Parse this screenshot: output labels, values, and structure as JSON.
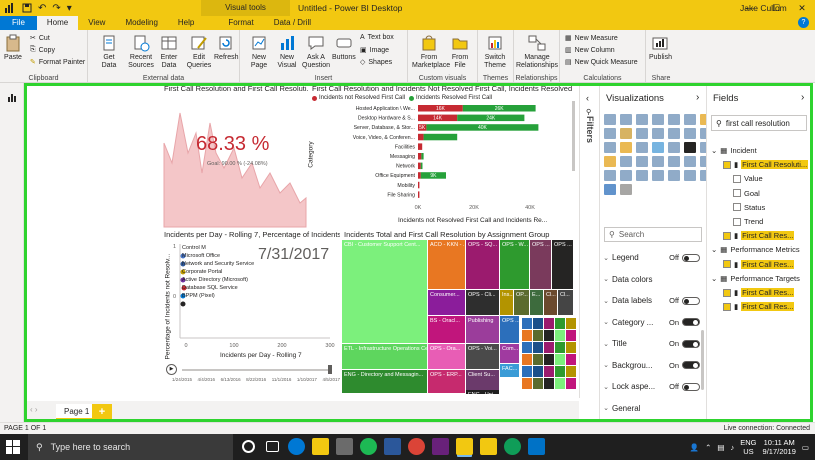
{
  "window": {
    "title": "Untitled - Power BI Desktop",
    "context_tab_group": "Visual tools",
    "user": "Jake Cullom"
  },
  "tabs": [
    {
      "label": "File"
    },
    {
      "label": "Home"
    },
    {
      "label": "View"
    },
    {
      "label": "Modeling"
    },
    {
      "label": "Help"
    },
    {
      "label": "Format"
    },
    {
      "label": "Data / Drill"
    }
  ],
  "ribbon": {
    "paste": "Paste",
    "cut": "Cut",
    "copy": "Copy",
    "format_painter": "Format Painter",
    "clipboard": "Clipboard",
    "get_data": "Get Data",
    "recent_sources": "Recent Sources",
    "enter_data": "Enter Data",
    "edit_queries": "Edit Queries",
    "external_data": "External data",
    "refresh": "Refresh",
    "new_page": "New Page",
    "new_visual": "New Visual",
    "ask_question": "Ask A Question",
    "buttons": "Buttons",
    "text_box": "Text box",
    "image": "Image",
    "shapes": "Shapes",
    "insert": "Insert",
    "from_marketplace": "From Marketplace",
    "from_file": "From File",
    "custom_visuals": "Custom visuals",
    "switch_theme": "Switch Theme",
    "themes": "Themes",
    "manage_relationships": "Manage Relationships",
    "relationships": "Relationships",
    "new_measure": "New Measure",
    "new_column": "New Column",
    "new_quick_measure": "New Quick Measure",
    "calculations": "Calculations",
    "publish": "Publish",
    "share": "Share"
  },
  "report": {
    "area_chart": {
      "title": "First Call Resolution and First Call Resoluti...",
      "kpi_value": "68.33 %",
      "goal_text": "Goal: 90.00 % (-24.08%)"
    },
    "bar_chart": {
      "title": "First Call Resolution and Incidents Not Resolved First Call, Incidents Resolved First Call and First Re...",
      "legend": [
        "Incidents not Resolved First Call",
        "Incidents Resolved First Call"
      ],
      "ylabel": "Category",
      "xlabel": "Incidents not Resolved First Call and Incidents Re...",
      "x_ticks": [
        "0K",
        "20K",
        "40K"
      ],
      "categories": [
        "Hosted Application \\ We...",
        "Desktop Hardware & S...",
        "Server, Database, & Stor...",
        "Voice, Video, & Conferen...",
        "Facilities",
        "Messaging",
        "Network",
        "Office Equipment",
        "Mobility",
        "File Sharing"
      ],
      "series": [
        {
          "name": "Incidents not Resolved First Call",
          "values": [
            16,
            14,
            3,
            2,
            1.5,
            1.2,
            1,
            1,
            0.5,
            0.5
          ],
          "labels": [
            "16K",
            "14K",
            "5K",
            "",
            "",
            "",
            "",
            "",
            "",
            ""
          ]
        },
        {
          "name": "Incidents Resolved First Call",
          "values": [
            26,
            24,
            40,
            12,
            0,
            0.8,
            0.6,
            9,
            0,
            0
          ],
          "labels": [
            "26K",
            "24K",
            "40K",
            "",
            "",
            "",
            "",
            "9K",
            "",
            ""
          ]
        }
      ]
    },
    "scatter_chart": {
      "title": "Incidents per Day - Rolling 7, Percentage of Incidents ...",
      "date_label": "7/31/2017",
      "legend": [
        "Control M",
        "Microsoft Office",
        "Network and Security Service",
        "Corporate Portal",
        "Active Directory (Microsoft)",
        "Database SQL Service",
        "BPPM (Pixel)"
      ],
      "xlabel": "Incidents per Day - Rolling 7",
      "ylabel": "Percentage of Incidents not Resolv...",
      "x_ticks": [
        "0",
        "100",
        "200",
        "300"
      ],
      "y_ticks": [
        "1",
        "0"
      ],
      "play_axis": [
        "1/24/2015",
        "4/4/2016",
        "6/13/2016",
        "8/22/2016",
        "11/1/2016",
        "1/10/2017",
        "4/5/2017"
      ]
    },
    "treemap": {
      "title": "Incidents Total and First Call Resolution by Assignment Group",
      "tiles": [
        "CBI - Customer Support Cent...",
        "ACO - KKN - ...",
        "OPS - SQ...",
        "OPS - W...",
        "OPS ...",
        "OPS ...",
        "Consumer...",
        "OPS - Cli...",
        "Ins...",
        "OP...",
        "E...",
        "Cl...",
        "Cl...",
        "BS - Oracl...",
        "Publishing",
        "OPS ...",
        "ETL - Infrastructure Operations Cen...",
        "OPS - Ora...",
        "OPS - Voi...",
        "Com...",
        "Client Su...",
        "FAC...",
        "ENG - Directory and Messagin...",
        "OPS - ERP...",
        "ENG - Uni..."
      ]
    }
  },
  "filters_label": "Filters",
  "viz_pane": {
    "title": "Visualizations",
    "search_placeholder": "Search",
    "format_items": [
      {
        "label": "Legend",
        "state": "Off"
      },
      {
        "label": "Data colors",
        "state": ""
      },
      {
        "label": "Data labels",
        "state": "Off"
      },
      {
        "label": "Category ...",
        "state": "On"
      },
      {
        "label": "Title",
        "state": "On"
      },
      {
        "label": "Backgrou...",
        "state": "On"
      },
      {
        "label": "Lock aspe...",
        "state": "Off"
      },
      {
        "label": "General",
        "state": ""
      }
    ]
  },
  "fields_pane": {
    "title": "Fields",
    "search_value": "first call resolution",
    "tables": [
      {
        "name": "Incident",
        "items": [
          "First Call Resoluti...",
          "Value",
          "Goal",
          "Status",
          "Trend",
          "First Call Res..."
        ]
      },
      {
        "name": "Performance Metrics",
        "items": [
          "First Call Res..."
        ]
      },
      {
        "name": "Performance Targets",
        "items": [
          "First Call Res...",
          "First Call Res..."
        ]
      }
    ]
  },
  "pages": [
    {
      "label": "Page 1"
    }
  ],
  "status": {
    "page": "PAGE 1 OF 1",
    "connection": "Live connection: Connected"
  },
  "taskbar": {
    "search_placeholder": "Type here to search",
    "lang_top": "ENG",
    "lang_bottom": "US",
    "time": "10:11 AM",
    "date": "9/17/2019"
  },
  "colors": {
    "accent": "#f2c811",
    "highlight_border": "#2ed32e",
    "bar_red": "#c62a32",
    "bar_green": "#26a13a",
    "area_fill": "#f4c6c8"
  }
}
